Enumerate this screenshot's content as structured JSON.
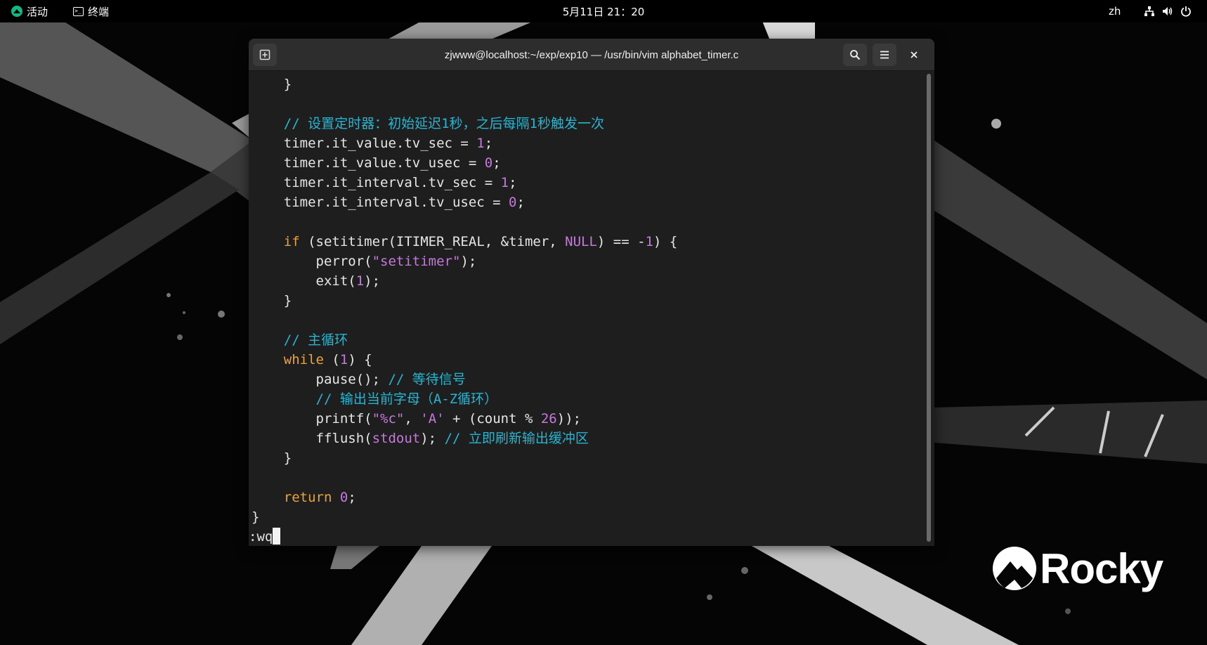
{
  "topbar": {
    "activities_label": "活动",
    "app_label": "终端",
    "clock": "5月11日 21：20",
    "input_lang": "zh"
  },
  "window": {
    "title": "zjwww@localhost:~/exp/exp10 — /usr/bin/vim alphabet_timer.c"
  },
  "icons": {
    "new_tab": "new-tab-icon",
    "search": "search-icon",
    "menu": "hamburger-menu-icon",
    "close": "close-icon",
    "network": "network-icon",
    "volume": "volume-icon",
    "power": "power-icon"
  },
  "editor": {
    "lines": [
      [
        {
          "t": "    }",
          "c": ""
        }
      ],
      [],
      [
        {
          "t": "    // 设置定时器：初始延迟1秒，之后每隔1秒触发一次",
          "c": "cm"
        }
      ],
      [
        {
          "t": "    timer.it_value.tv_sec = ",
          "c": ""
        },
        {
          "t": "1",
          "c": "num"
        },
        {
          "t": ";",
          "c": ""
        }
      ],
      [
        {
          "t": "    timer.it_value.tv_usec = ",
          "c": ""
        },
        {
          "t": "0",
          "c": "num"
        },
        {
          "t": ";",
          "c": ""
        }
      ],
      [
        {
          "t": "    timer.it_interval.tv_sec = ",
          "c": ""
        },
        {
          "t": "1",
          "c": "num"
        },
        {
          "t": ";",
          "c": ""
        }
      ],
      [
        {
          "t": "    timer.it_interval.tv_usec = ",
          "c": ""
        },
        {
          "t": "0",
          "c": "num"
        },
        {
          "t": ";",
          "c": ""
        }
      ],
      [],
      [
        {
          "t": "    ",
          "c": ""
        },
        {
          "t": "if",
          "c": "kw"
        },
        {
          "t": " (setitimer(ITIMER_REAL, &timer, ",
          "c": ""
        },
        {
          "t": "NULL",
          "c": "num"
        },
        {
          "t": ") == -",
          "c": ""
        },
        {
          "t": "1",
          "c": "num"
        },
        {
          "t": ") {",
          "c": ""
        }
      ],
      [
        {
          "t": "        perror(",
          "c": ""
        },
        {
          "t": "\"setitimer\"",
          "c": "str"
        },
        {
          "t": ");",
          "c": ""
        }
      ],
      [
        {
          "t": "        exit(",
          "c": ""
        },
        {
          "t": "1",
          "c": "num"
        },
        {
          "t": ");",
          "c": ""
        }
      ],
      [
        {
          "t": "    }",
          "c": ""
        }
      ],
      [],
      [
        {
          "t": "    // 主循环",
          "c": "cm"
        }
      ],
      [
        {
          "t": "    ",
          "c": ""
        },
        {
          "t": "while",
          "c": "kw"
        },
        {
          "t": " (",
          "c": ""
        },
        {
          "t": "1",
          "c": "num"
        },
        {
          "t": ") {",
          "c": ""
        }
      ],
      [
        {
          "t": "        pause(); ",
          "c": ""
        },
        {
          "t": "// 等待信号",
          "c": "cm"
        }
      ],
      [
        {
          "t": "        // 输出当前字母（A-Z循环）",
          "c": "cm"
        }
      ],
      [
        {
          "t": "        printf(",
          "c": ""
        },
        {
          "t": "\"%c\"",
          "c": "str"
        },
        {
          "t": ", ",
          "c": ""
        },
        {
          "t": "'A'",
          "c": "str"
        },
        {
          "t": " + (count % ",
          "c": ""
        },
        {
          "t": "26",
          "c": "num"
        },
        {
          "t": "));",
          "c": ""
        }
      ],
      [
        {
          "t": "        fflush(",
          "c": ""
        },
        {
          "t": "stdout",
          "c": "num"
        },
        {
          "t": "); ",
          "c": ""
        },
        {
          "t": "// 立即刷新输出缓冲区",
          "c": "cm"
        }
      ],
      [
        {
          "t": "    }",
          "c": ""
        }
      ],
      [],
      [
        {
          "t": "    ",
          "c": ""
        },
        {
          "t": "return",
          "c": "kw"
        },
        {
          "t": " ",
          "c": ""
        },
        {
          "t": "0",
          "c": "num"
        },
        {
          "t": ";",
          "c": ""
        }
      ],
      [
        {
          "t": "}",
          "c": ""
        }
      ]
    ],
    "command_line": ":wq"
  },
  "brand": {
    "logo_text": "Rocky"
  },
  "colors": {
    "keyword": "#e8a33d",
    "constant": "#c678dd",
    "comment": "#27b5d2",
    "text": "#e6e6e6",
    "background": "#1e1e1e"
  }
}
